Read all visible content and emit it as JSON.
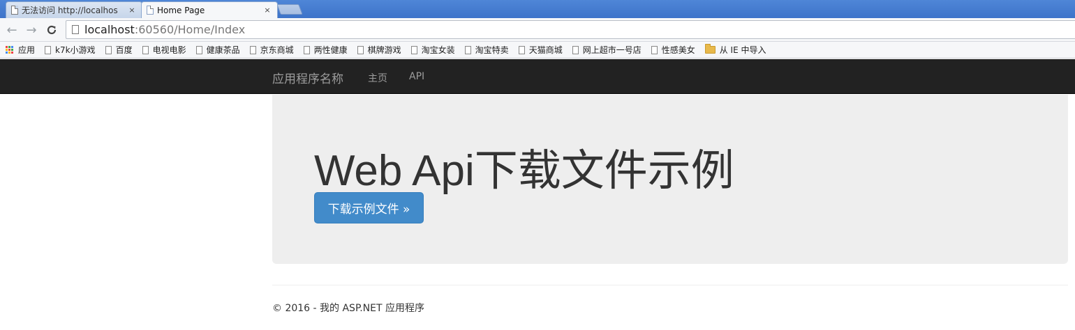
{
  "browser": {
    "tabs": [
      {
        "title": "无法访问 http://localhos",
        "active": false
      },
      {
        "title": "Home Page",
        "active": true
      }
    ],
    "close_glyph": "×",
    "url": {
      "host": "localhost",
      "path": ":60560/Home/Index"
    },
    "nav": {
      "back_glyph": "←",
      "forward_glyph": "→",
      "reload_glyph": "C"
    },
    "bookmarks": {
      "apps_label": "应用",
      "items": [
        "k7k小游戏",
        "百度",
        "电视电影",
        "健康茶品",
        "京东商城",
        "两性健康",
        "棋牌游戏",
        "淘宝女装",
        "淘宝特卖",
        "天猫商城",
        "网上超市一号店",
        "性感美女"
      ],
      "folder_label": "从 IE 中导入"
    }
  },
  "page": {
    "brand": "应用程序名称",
    "nav": {
      "home": "主页",
      "api": "API"
    },
    "jumbotron": {
      "heading": "Web Api下载文件示例",
      "button_label": "下载示例文件 »"
    },
    "footer": "© 2016 - 我的 ASP.NET 应用程序"
  },
  "colors": {
    "navbar_bg": "#222222",
    "navbar_text": "#9d9d9d",
    "jumbotron_bg": "#eeeeee",
    "button_bg": "#428bca",
    "tabstrip_bg": "#3d73c9"
  }
}
